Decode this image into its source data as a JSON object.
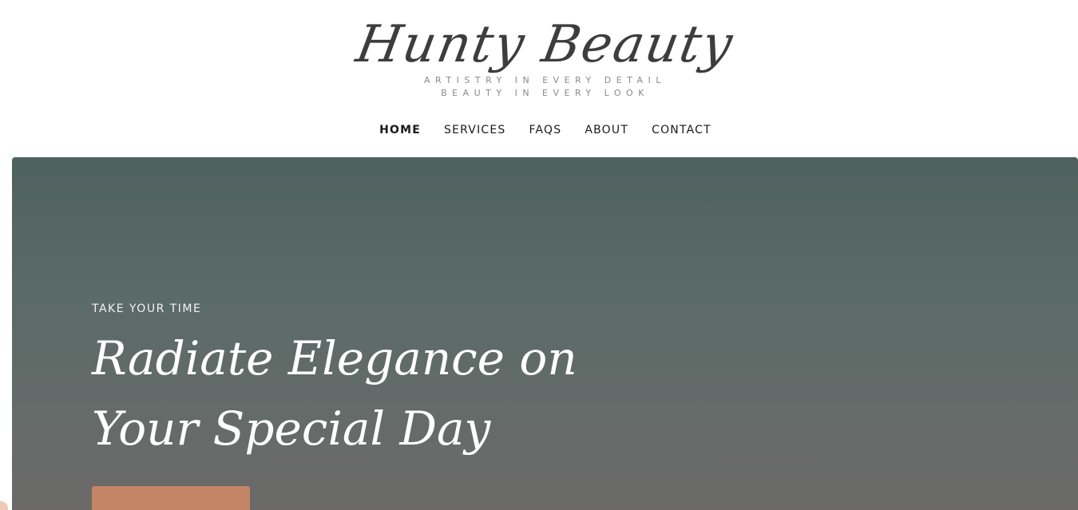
{
  "brand": {
    "name": "Hunty Beauty",
    "tagline_line1": "ARTISTRY IN EVERY DETAIL",
    "tagline_line2": "BEAUTY IN EVERY LOOK",
    "logo_color": "#3d3d3d"
  },
  "nav": {
    "items": [
      {
        "label": "HOME",
        "active": true
      },
      {
        "label": "SERVICES",
        "active": false
      },
      {
        "label": "FAQS",
        "active": false
      },
      {
        "label": "ABOUT",
        "active": false
      },
      {
        "label": "CONTACT",
        "active": false
      }
    ]
  },
  "hero": {
    "eyebrow": "TAKE YOUR TIME",
    "headline_line1": "Radiate Elegance on",
    "headline_line2": "Your Special Day",
    "background_top_color": "#4f615e",
    "background_bottom_color": "#6c6a69",
    "cta_color": "#c48466"
  }
}
